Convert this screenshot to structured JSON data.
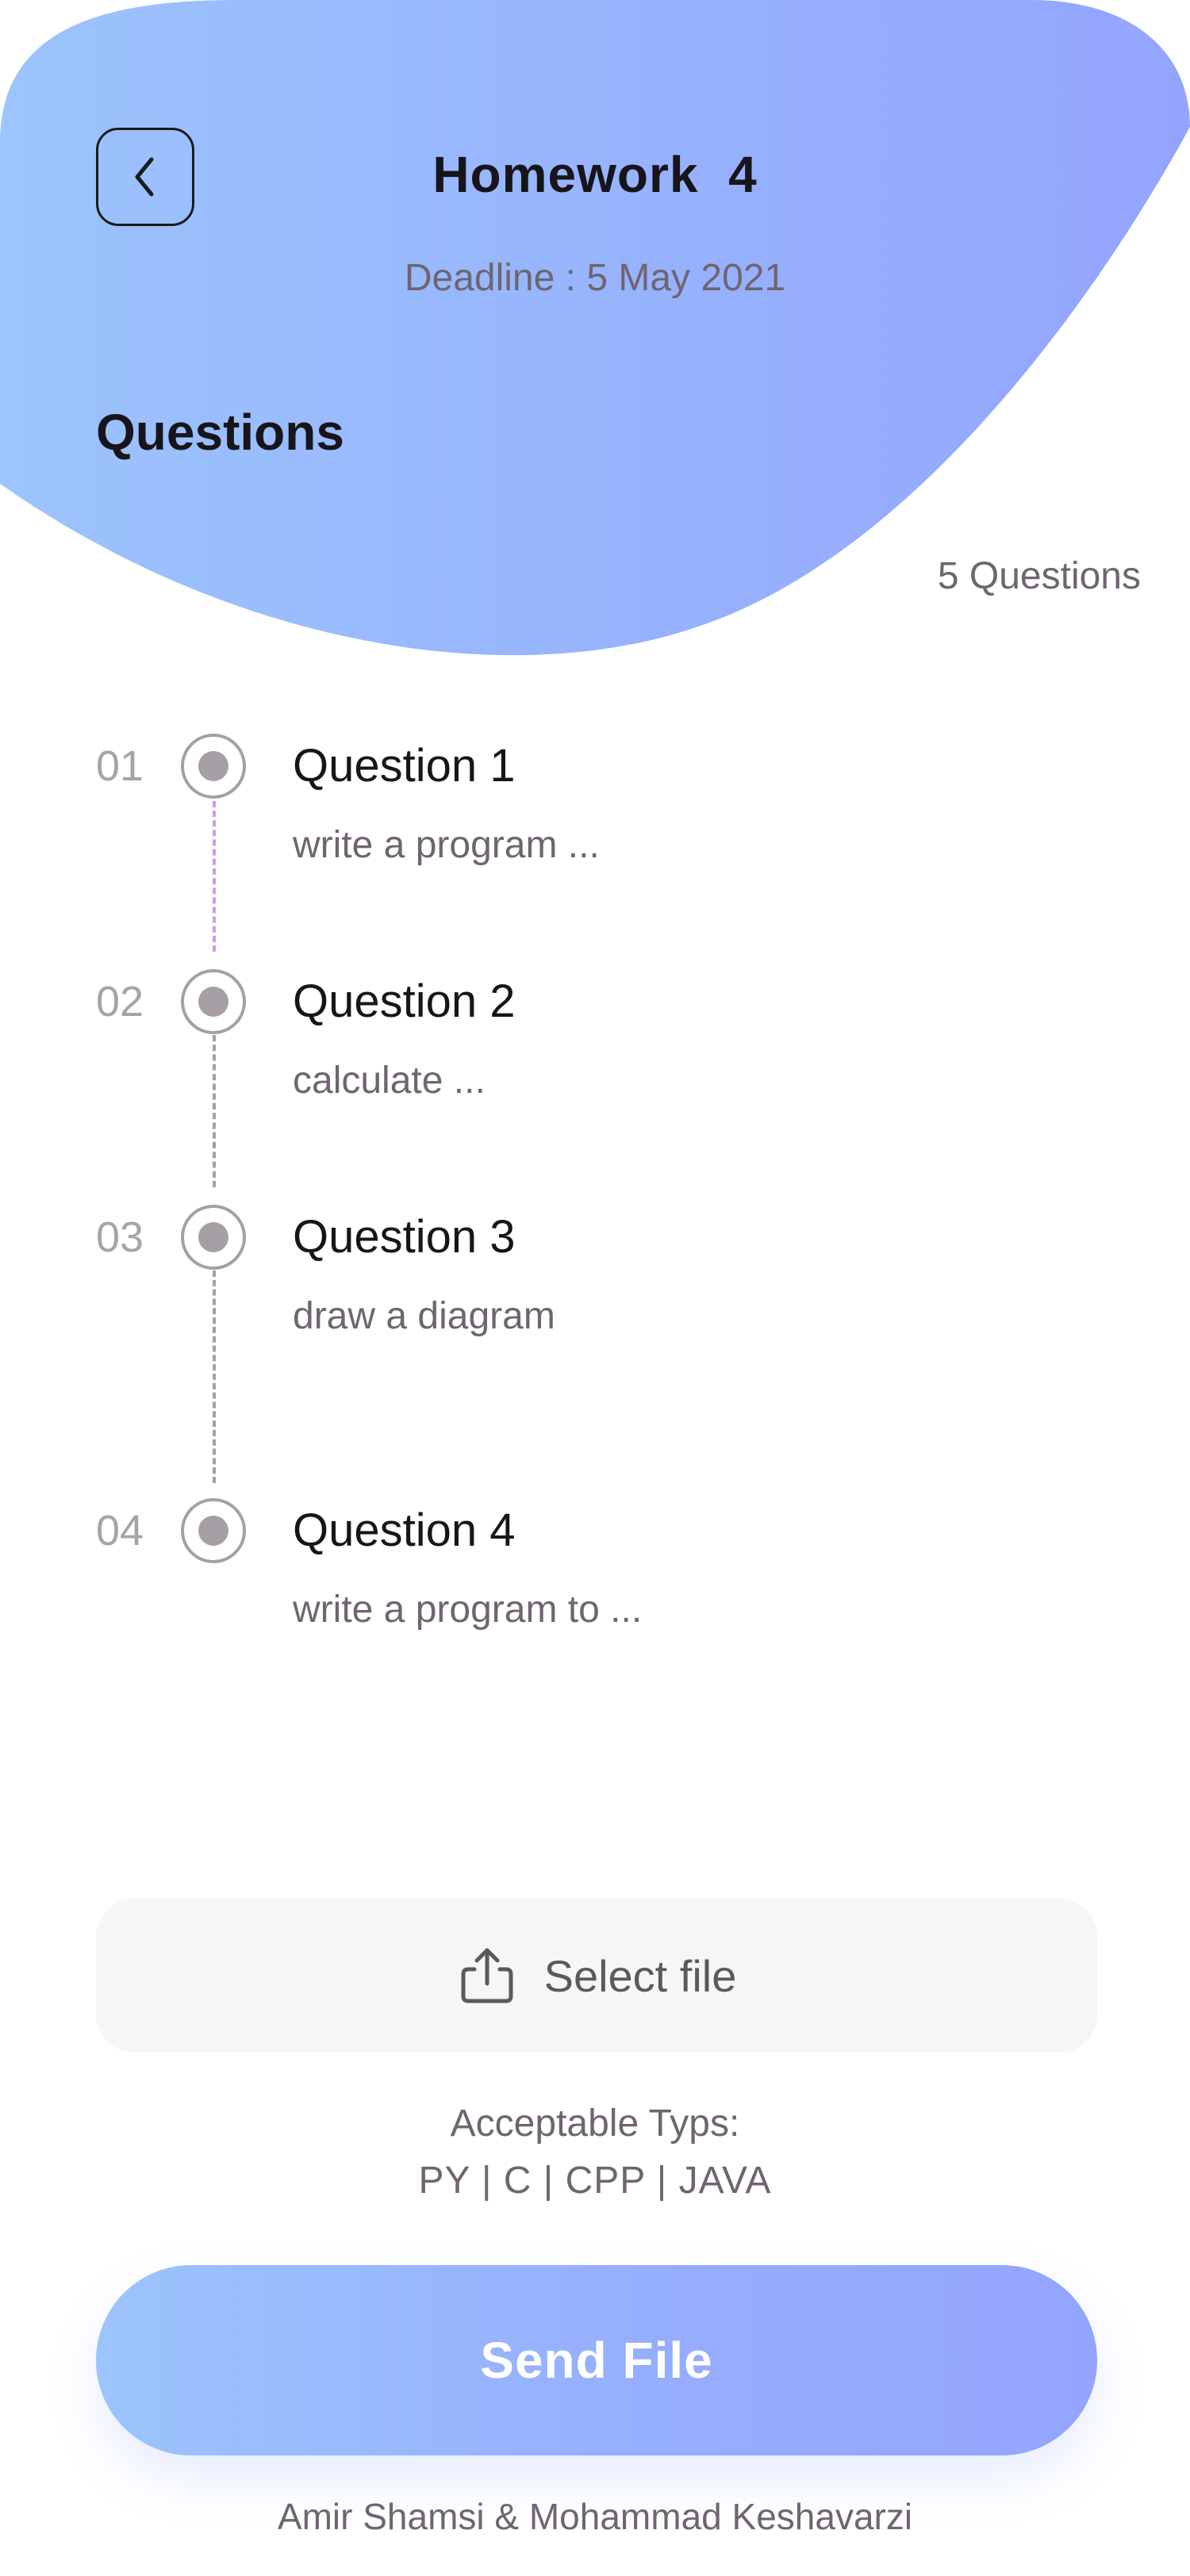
{
  "header": {
    "title": "Homework  4",
    "deadline": "Deadline : 5 May 2021"
  },
  "section": {
    "title": "Questions",
    "count": "5 Questions"
  },
  "questions": [
    {
      "number": "01",
      "title": "Question 1",
      "description": "write a program ..."
    },
    {
      "number": "02",
      "title": "Question 2",
      "description": "calculate ..."
    },
    {
      "number": "03",
      "title": "Question 3",
      "description": "draw a diagram"
    },
    {
      "number": "04",
      "title": "Question 4",
      "description": "write a program to ..."
    }
  ],
  "upload": {
    "select_label": "Select file",
    "acceptable_label": "Acceptable Typs:",
    "acceptable_types": "PY | C | CPP | JAVA"
  },
  "send_button": "Send File",
  "credits": "Amir Shamsi & Mohammad Keshavarzi",
  "colors": {
    "gradient_start": "#9cc4fd",
    "gradient_end": "#93a4fd",
    "timeline_accent": "#cf9be0",
    "text_dark": "#17151a",
    "text_muted": "#6f6570"
  }
}
